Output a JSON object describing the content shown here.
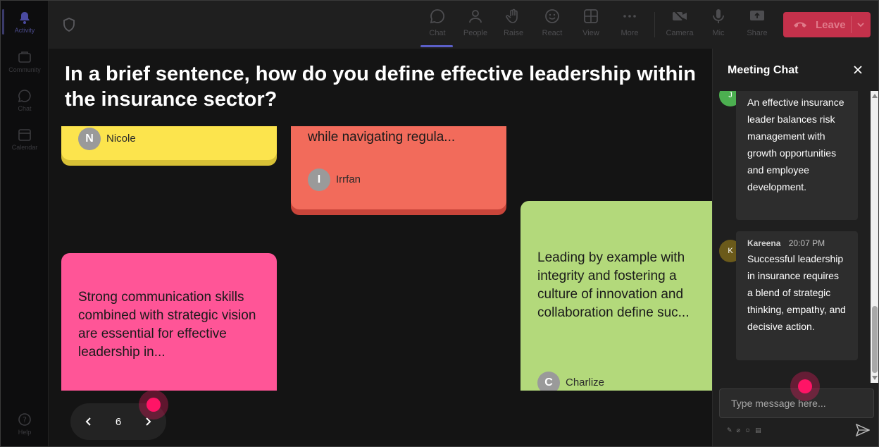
{
  "rail": {
    "items": [
      {
        "label": "Activity"
      },
      {
        "label": "Community"
      },
      {
        "label": "Chat"
      },
      {
        "label": "Calendar"
      }
    ],
    "help": "Help"
  },
  "toolbar": {
    "chat": "Chat",
    "people": "People",
    "raise": "Raise",
    "react": "React",
    "view": "View",
    "more": "More",
    "camera": "Camera",
    "mic": "Mic",
    "share": "Share",
    "leave": "Leave"
  },
  "main": {
    "question": "In a brief sentence, how do you define effective leadership within the insurance sector?",
    "notes": [
      {
        "text": "",
        "author": "Nicole",
        "initial": "N",
        "color": "#fce44d",
        "shadow": "#d8c136"
      },
      {
        "text": "while navigating regula...",
        "author": "Irrfan",
        "initial": "I",
        "color": "#f26b5b",
        "shadow": "#c9453a"
      },
      {
        "text": "Strong communication skills combined with strategic vision are essential for effective leadership in...",
        "author": "",
        "initial": "",
        "color": "#ff5597",
        "shadow": "#d23f79"
      },
      {
        "text": "Leading by example with integrity and fostering a culture of innovation and collaboration define suc...",
        "author": "Charlize",
        "initial": "C",
        "color": "#b3d97b",
        "shadow": "#8fb55c"
      }
    ],
    "page": "6"
  },
  "chat": {
    "title": "Meeting Chat",
    "messages": [
      {
        "initial": "J",
        "avatar_color": "#4caf50",
        "name": "",
        "time": "",
        "text": "An effective insurance leader balances risk management with growth opportunities and employee development."
      },
      {
        "initial": "K",
        "avatar_color": "#6b5a1a",
        "name": "Kareena",
        "time": "20:07 PM",
        "text": "Successful leadership in insurance requires a blend of strategic thinking, empathy, and decisive action."
      }
    ],
    "input_placeholder": "Type message here..."
  }
}
